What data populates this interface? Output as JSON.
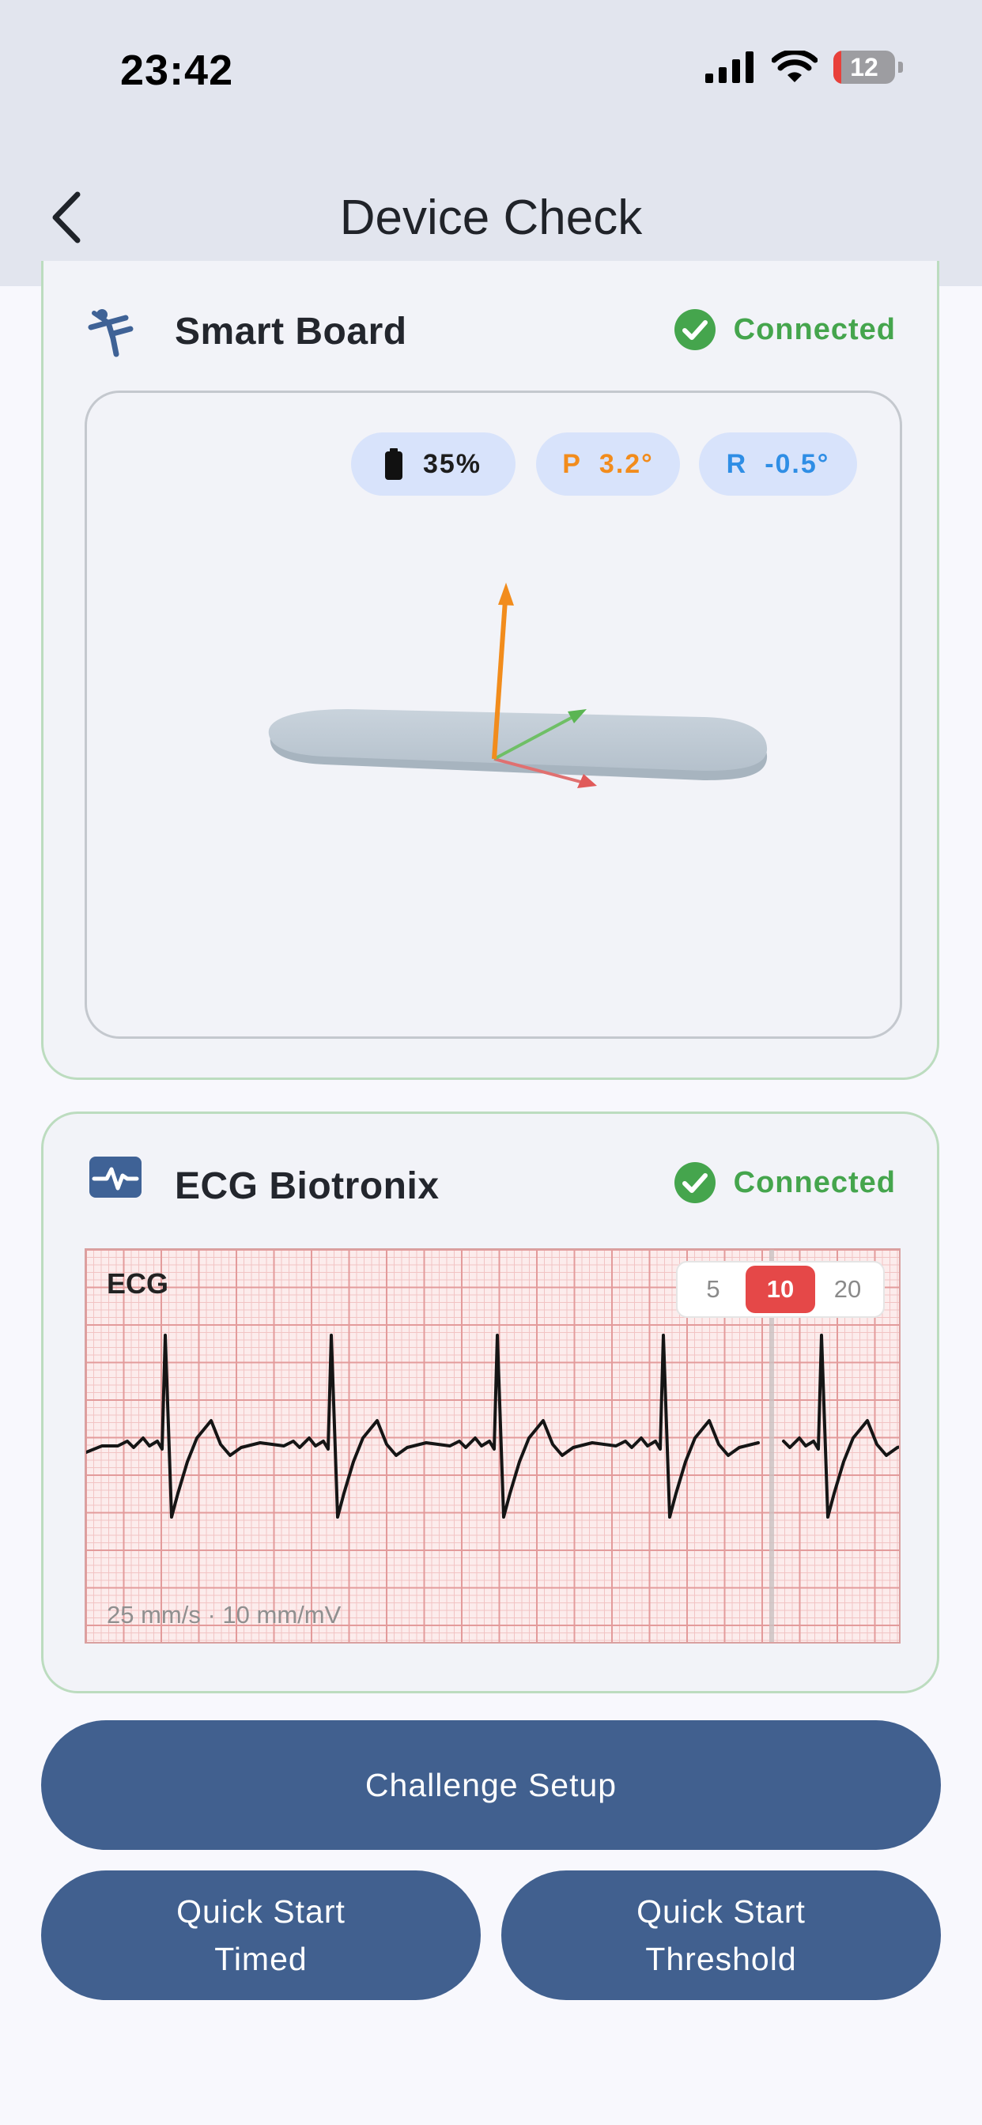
{
  "status_bar": {
    "time": "23:42",
    "battery": "12"
  },
  "nav": {
    "title": "Device Check"
  },
  "smart_board": {
    "name": "Smart Board",
    "status": "Connected",
    "battery": "35%",
    "pitch_prefix": "P",
    "pitch_value": "3.2°",
    "roll_prefix": "R",
    "roll_value": "-0.5°"
  },
  "ecg_device": {
    "name": "ECG Biotronix",
    "status": "Connected",
    "chart_label": "ECG",
    "scale_text": "25 mm/s · 10 mm/mV",
    "gain_options": [
      "5",
      "10",
      "20"
    ],
    "gain_selected": "10"
  },
  "actions": {
    "challenge_setup": "Challenge Setup",
    "quick_start_timed_line1": "Quick Start",
    "quick_start_timed_line2": "Timed",
    "quick_start_threshold_line1": "Quick Start",
    "quick_start_threshold_line2": "Threshold"
  },
  "colors": {
    "primary": "#41608f",
    "connected": "#45a54d",
    "pitch": "#f28c1c",
    "roll": "#2f8ee5",
    "ecg_grid": "#e39b9b",
    "gain_active": "#e54848"
  },
  "icons": {
    "smart_board": "figure-balance-icon",
    "ecg": "waveform-monitor-icon",
    "connected": "check-circle-icon",
    "back": "chevron-left-icon"
  }
}
